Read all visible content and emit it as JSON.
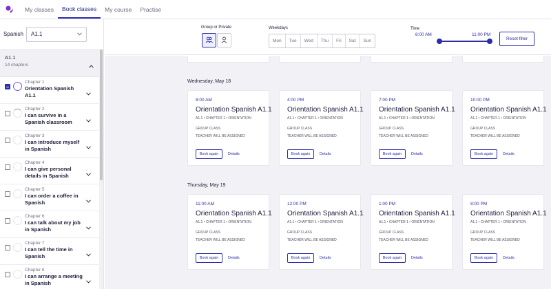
{
  "nav": {
    "items": [
      {
        "label": "My classes",
        "active": false
      },
      {
        "label": "Book classes",
        "active": true
      },
      {
        "label": "My course",
        "active": false
      },
      {
        "label": "Practise",
        "active": false
      }
    ]
  },
  "sidebar": {
    "language_label": "Spanish",
    "level_select_value": "A1.1",
    "level": {
      "title": "A1.1",
      "subtitle": "14 chapters"
    },
    "chapters": [
      {
        "number": "Chapter 1",
        "title": "Orientation Spanish A1.1",
        "checked": true
      },
      {
        "number": "Chapter 2",
        "title": "I can survive in a Spanish classroom",
        "checked": false
      },
      {
        "number": "Chapter 3",
        "title": "I can introduce myself in Spanish",
        "checked": false
      },
      {
        "number": "Chapter 4",
        "title": "I can give personal details in Spanish",
        "checked": false
      },
      {
        "number": "Chapter 5",
        "title": "I can order a coffee in Spanish",
        "checked": false
      },
      {
        "number": "Chapter 6",
        "title": "I can talk about my job in Spanish",
        "checked": false
      },
      {
        "number": "Chapter 7",
        "title": "I can tell the time in Spanish",
        "checked": false
      },
      {
        "number": "Chapter 8",
        "title": "I can arrange a meeting in Spanish",
        "checked": false
      }
    ]
  },
  "filters": {
    "group_label": "Group or Private",
    "weekdays_label": "Weekdays",
    "weekdays": [
      "Mon",
      "Tue",
      "Wed",
      "Thu",
      "Fri",
      "Sat",
      "Sun"
    ],
    "time_label": "Time",
    "time_start": "8:00 AM",
    "time_end": "11:00 PM",
    "reset_label": "Reset filter"
  },
  "days": [
    {
      "heading": "Wednesday, May 18",
      "classes": [
        {
          "time": "8:00 AM",
          "title": "Orientation Spanish A1.1",
          "meta": "A1.1 • CHAPTER 1 • ORIENTATION",
          "type": "GROUP CLASS",
          "teacher": "TEACHER WILL BE ASSIGNED",
          "book_label": "Book again",
          "details_label": "Details"
        },
        {
          "time": "4:00 PM",
          "title": "Orientation Spanish A1.1",
          "meta": "A1.1 • CHAPTER 1 • ORIENTATION",
          "type": "GROUP CLASS",
          "teacher": "TEACHER WILL BE ASSIGNED",
          "book_label": "Book again",
          "details_label": "Details"
        },
        {
          "time": "7:00 PM",
          "title": "Orientation Spanish A1.1",
          "meta": "A1.1 • CHAPTER 1 • ORIENTATION",
          "type": "GROUP CLASS",
          "teacher": "TEACHER WILL BE ASSIGNED",
          "book_label": "Book again",
          "details_label": "Details"
        },
        {
          "time": "10:00 PM",
          "title": "Orientation Spanish A1.1",
          "meta": "A1.1 • CHAPTER 1 • ORIENTATION",
          "type": "GROUP CLASS",
          "teacher": "TEACHER WILL BE ASSIGNED",
          "book_label": "Book again",
          "details_label": "Details"
        }
      ]
    },
    {
      "heading": "Thursday, May 19",
      "classes": [
        {
          "time": "11:00 AM",
          "title": "Orientation Spanish A1.1",
          "meta": "A1.1 • CHAPTER 1 • ORIENTATION",
          "type": "GROUP CLASS",
          "teacher": "TEACHER WILL BE ASSIGNED",
          "book_label": "Book again",
          "details_label": "Details"
        },
        {
          "time": "12:00 PM",
          "title": "Orientation Spanish A1.1",
          "meta": "A1.1 • CHAPTER 1 • ORIENTATION",
          "type": "GROUP CLASS",
          "teacher": "TEACHER WILL BE ASSIGNED",
          "book_label": "Book again",
          "details_label": "Details"
        },
        {
          "time": "1:00 PM",
          "title": "Orientation Spanish A1.1",
          "meta": "A1.1 • CHAPTER 1 • ORIENTATION",
          "type": "GROUP CLASS",
          "teacher": "TEACHER WILL BE ASSIGNED",
          "book_label": "Book again",
          "details_label": "Details"
        },
        {
          "time": "8:00 PM",
          "title": "Orientation Spanish A1.1",
          "meta": "A1.1 • CHAPTER 1 • ORIENTATION",
          "type": "GROUP CLASS",
          "teacher": "TEACHER WILL BE ASSIGNED",
          "book_label": "Book again",
          "details_label": "Details"
        }
      ]
    }
  ],
  "icons": {
    "logo": "brand-logo-icon",
    "dropdown": "chevron-down-icon",
    "collapse": "chevron-up-icon",
    "group": "group-people-icon",
    "private": "person-icon"
  },
  "colors": {
    "accent": "#2d2da8",
    "logo": "#7b2fd0",
    "page_bg": "#f2f2f6"
  }
}
